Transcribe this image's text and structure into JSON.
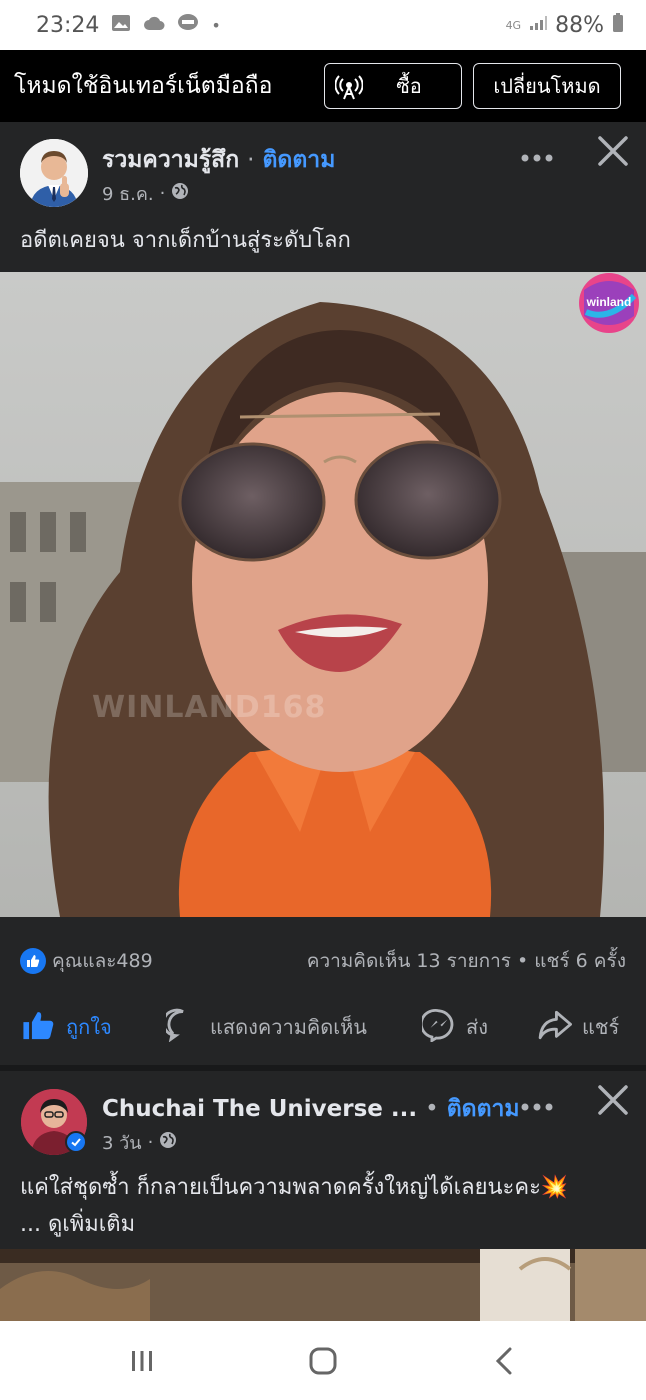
{
  "status_bar": {
    "time": "23:24",
    "dot": "•",
    "network": "4G",
    "battery": "88%"
  },
  "mode_bar": {
    "text": "โหมดใช้อินเทอร์เน็ตมือถือ",
    "buy_label": "ซื้อ",
    "switch_label": "เปลี่ยนโหมด"
  },
  "post1": {
    "author": "รวมความรู้สึก",
    "separator": "·",
    "follow_label": "ติดตาม",
    "date": "9 ธ.ค.",
    "meta_sep": "·",
    "text": "อดีตเคยจน จากเด็กบ้านสู่ระดับโลก",
    "photo": {
      "logo_text": "winland",
      "watermark": "WINLAND168"
    },
    "reactions": {
      "summary": "คุณและ489",
      "stats": "ความคิดเห็น 13 รายการ • แชร์ 6 ครั้ง"
    },
    "actions": {
      "like": "ถูกใจ",
      "comment": "แสดงความคิดเห็น",
      "send": "ส่ง",
      "share": "แชร์"
    }
  },
  "post2": {
    "author": "Chuchai The Universe ...",
    "separator": "•",
    "follow_label": "ติดตาม",
    "date": "3 วัน",
    "meta_sep": "·",
    "text_line1": "แค่ใส่ชุดซ้ำ ก็กลายเป็นความพลาดครั้งใหญ่ได้เลยนะคะ💥",
    "text_line2": "... ดูเพิ่มเติม"
  },
  "colors": {
    "background": "#242526",
    "follow": "#4599ff",
    "like_active": "#2d88ff",
    "muted": "#b0b3b8"
  }
}
